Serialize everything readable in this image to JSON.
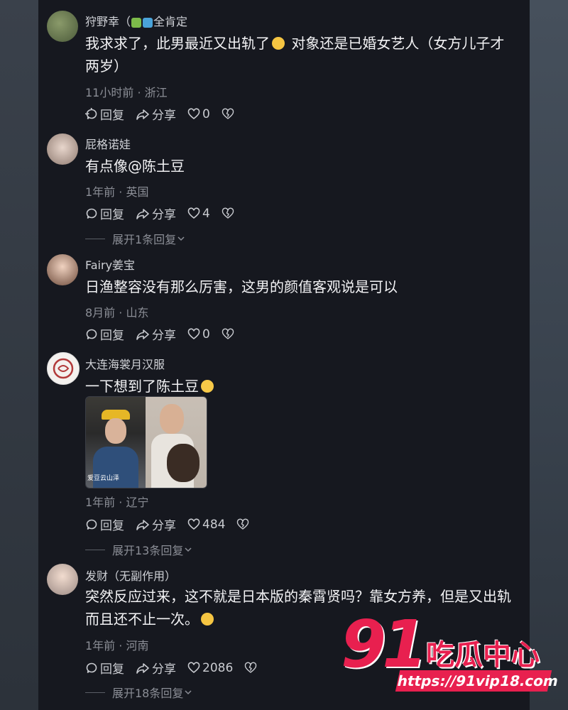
{
  "comments": [
    {
      "username": "狩野幸（",
      "username_suffix": "全肯定",
      "text_before": "我求求了，此男最近又出轨了",
      "text_after": " 对象还是已婚女艺人（女方儿子才两岁）",
      "meta": "11小时前 · 浙江",
      "reply": "回复",
      "share": "分享",
      "likes": "0"
    },
    {
      "username": "屁格诺娃",
      "text": "有点像@陈土豆",
      "meta": "1年前 · 英国",
      "reply": "回复",
      "share": "分享",
      "likes": "4",
      "expand": "展开1条回复"
    },
    {
      "username": "Fairy姜宝",
      "text": "日渔整容没有那么厉害，这男的颜值客观说是可以",
      "meta": "8月前 · 山东",
      "reply": "回复",
      "share": "分享",
      "likes": "0"
    },
    {
      "username": "大连海裳月汉服",
      "text": "一下想到了陈土豆",
      "meta": "1年前 · 辽宁",
      "reply": "回复",
      "share": "分享",
      "likes": "484",
      "expand": "展开13条回复",
      "image_caption": "爱豆云山泽"
    },
    {
      "username": "发财（无副作用）",
      "text": "突然反应过来，这不就是日本版的秦霄贤吗？靠女方养，但是又出轨而且还不止一次。",
      "meta": "1年前 · 河南",
      "reply": "回复",
      "share": "分享",
      "likes": "2086",
      "expand": "展开18条回复"
    }
  ],
  "watermark": {
    "number": "91",
    "title": "吃瓜中心",
    "url": "https://91vip18.com"
  },
  "colors": {
    "panel": "#16181f",
    "accent": "#e8204f"
  }
}
